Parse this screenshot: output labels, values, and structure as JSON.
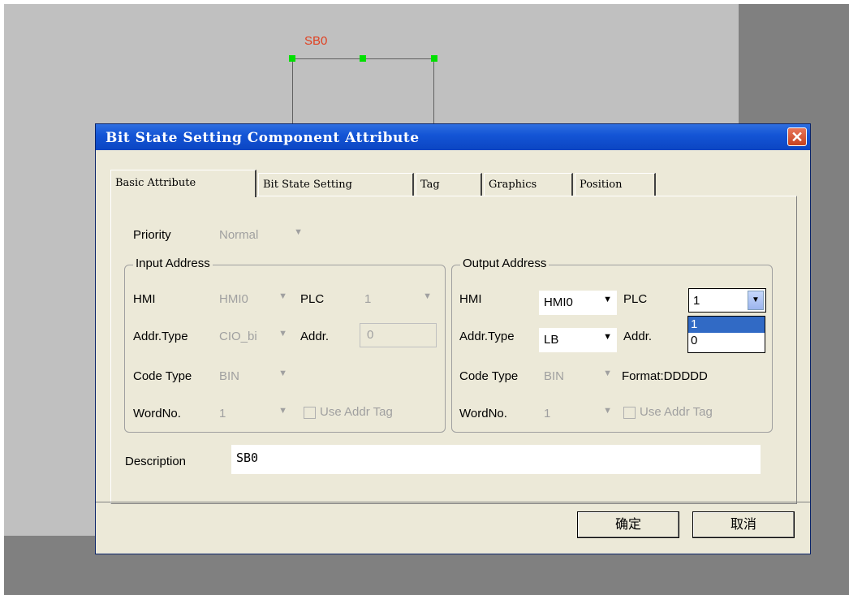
{
  "canvas": {
    "component_label": "SB0"
  },
  "dialog": {
    "title": "Bit State Setting Component Attribute",
    "close_glyph": "✕",
    "tabs": [
      "Basic Attribute",
      "Bit State Setting",
      "Tag",
      "Graphics",
      "Position"
    ],
    "priority": {
      "label": "Priority",
      "value": "Normal"
    },
    "input_address": {
      "title": "Input Address",
      "hmi_label": "HMI",
      "hmi_value": "HMI0",
      "plc_label": "PLC",
      "plc_value": "1",
      "addr_type_label": "Addr.Type",
      "addr_type_value": "CIO_bi",
      "addr_label": "Addr.",
      "addr_value": "0",
      "code_type_label": "Code Type",
      "code_type_value": "BIN",
      "wordno_label": "WordNo.",
      "wordno_value": "1",
      "use_addr_tag_label": "Use Addr Tag"
    },
    "output_address": {
      "title": "Output Address",
      "hmi_label": "HMI",
      "hmi_value": "HMI0",
      "plc_label": "PLC",
      "plc_value": "1",
      "plc_options": [
        "1",
        "0"
      ],
      "addr_type_label": "Addr.Type",
      "addr_type_value": "LB",
      "addr_label": "Addr.",
      "code_type_label": "Code Type",
      "code_type_value": "BIN",
      "format_label": "Format:DDDDD",
      "wordno_label": "WordNo.",
      "wordno_value": "1",
      "use_addr_tag_label": "Use Addr Tag"
    },
    "description": {
      "label": "Description",
      "value": "SB0"
    },
    "ok_label": "确定",
    "cancel_label": "取消"
  }
}
